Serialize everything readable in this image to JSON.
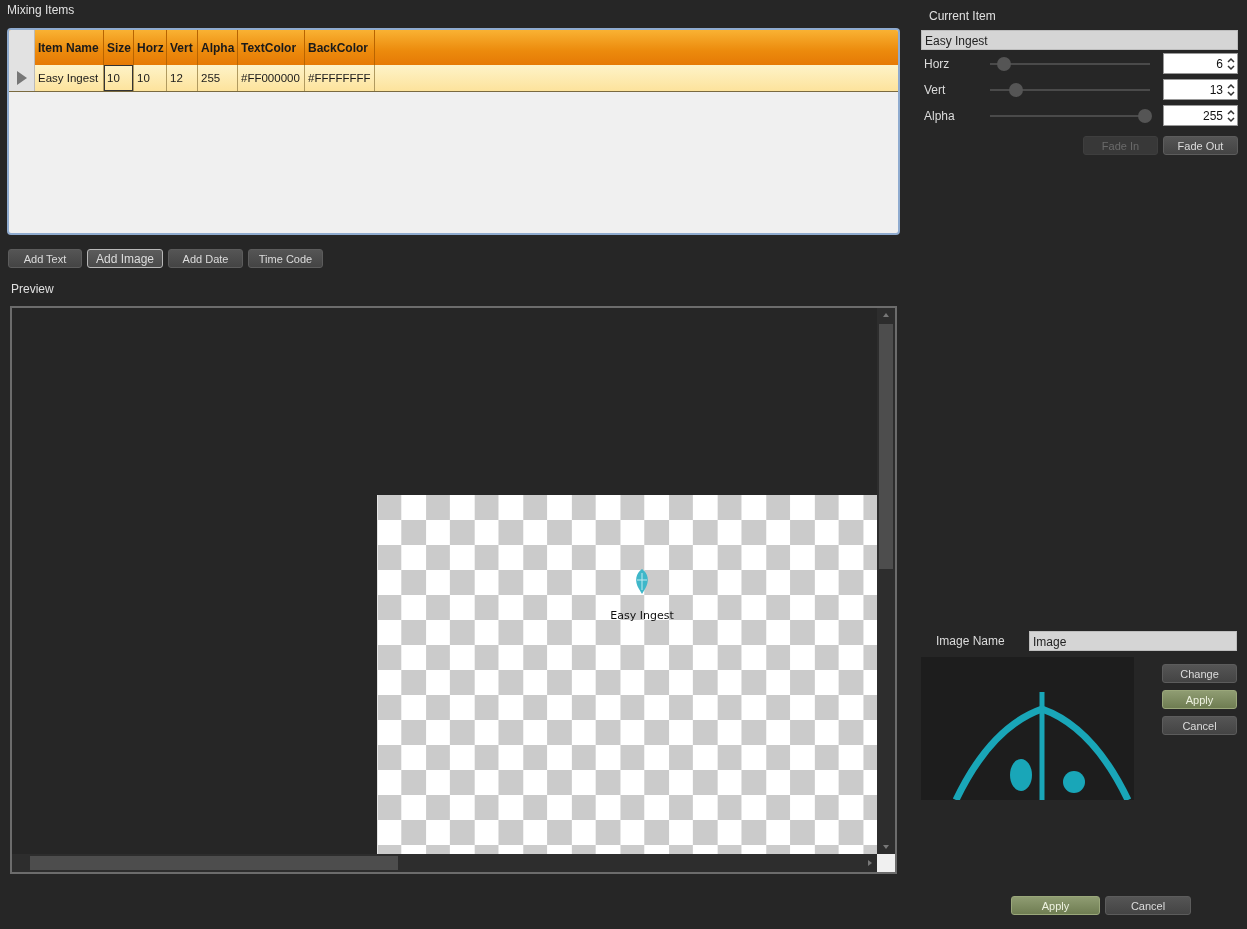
{
  "mixing_items": {
    "title": "Mixing Items",
    "columns": [
      "Item Name",
      "Size",
      "Horz",
      "Vert",
      "Alpha",
      "TextColor",
      "BackColor"
    ],
    "rows": [
      {
        "selected": true,
        "cells": [
          {
            "text": "Easy Ingest",
            "focused": false
          },
          {
            "text": "10",
            "focused": true
          },
          {
            "text": "10",
            "focused": false
          },
          {
            "text": "12",
            "focused": false
          },
          {
            "text": "255",
            "focused": false
          },
          {
            "text": "#FF000000",
            "focused": false
          },
          {
            "text": "#FFFFFFFF",
            "focused": false
          }
        ]
      }
    ]
  },
  "add_buttons": [
    {
      "label": "Add Text",
      "focused": false
    },
    {
      "label": "Add Image",
      "focused": true
    },
    {
      "label": "Add Date",
      "focused": false
    },
    {
      "label": "Time Code",
      "focused": false
    }
  ],
  "preview": {
    "title": "Preview",
    "caption": "Easy Ingest"
  },
  "current_item": {
    "title": "Current Item",
    "name": "Easy Ingest",
    "sliders": [
      {
        "label": "Horz",
        "level": 0.09,
        "value": "6"
      },
      {
        "label": "Vert",
        "level": 0.16,
        "value": "13"
      },
      {
        "label": "Alpha",
        "level": 0.97,
        "value": "255"
      }
    ],
    "fade_buttons": [
      {
        "label": "Fade In",
        "disabled": true
      },
      {
        "label": "Fade Out",
        "disabled": false
      }
    ]
  },
  "image": {
    "label": "Image Name",
    "value": "Image",
    "buttons": [
      {
        "label": "Change",
        "kind": "normal"
      },
      {
        "label": "Apply",
        "kind": "accent"
      },
      {
        "label": "Cancel",
        "kind": "normal"
      }
    ]
  },
  "footer_buttons": [
    {
      "label": "Apply",
      "kind": "accent"
    },
    {
      "label": "Cancel",
      "kind": "normal"
    }
  ]
}
